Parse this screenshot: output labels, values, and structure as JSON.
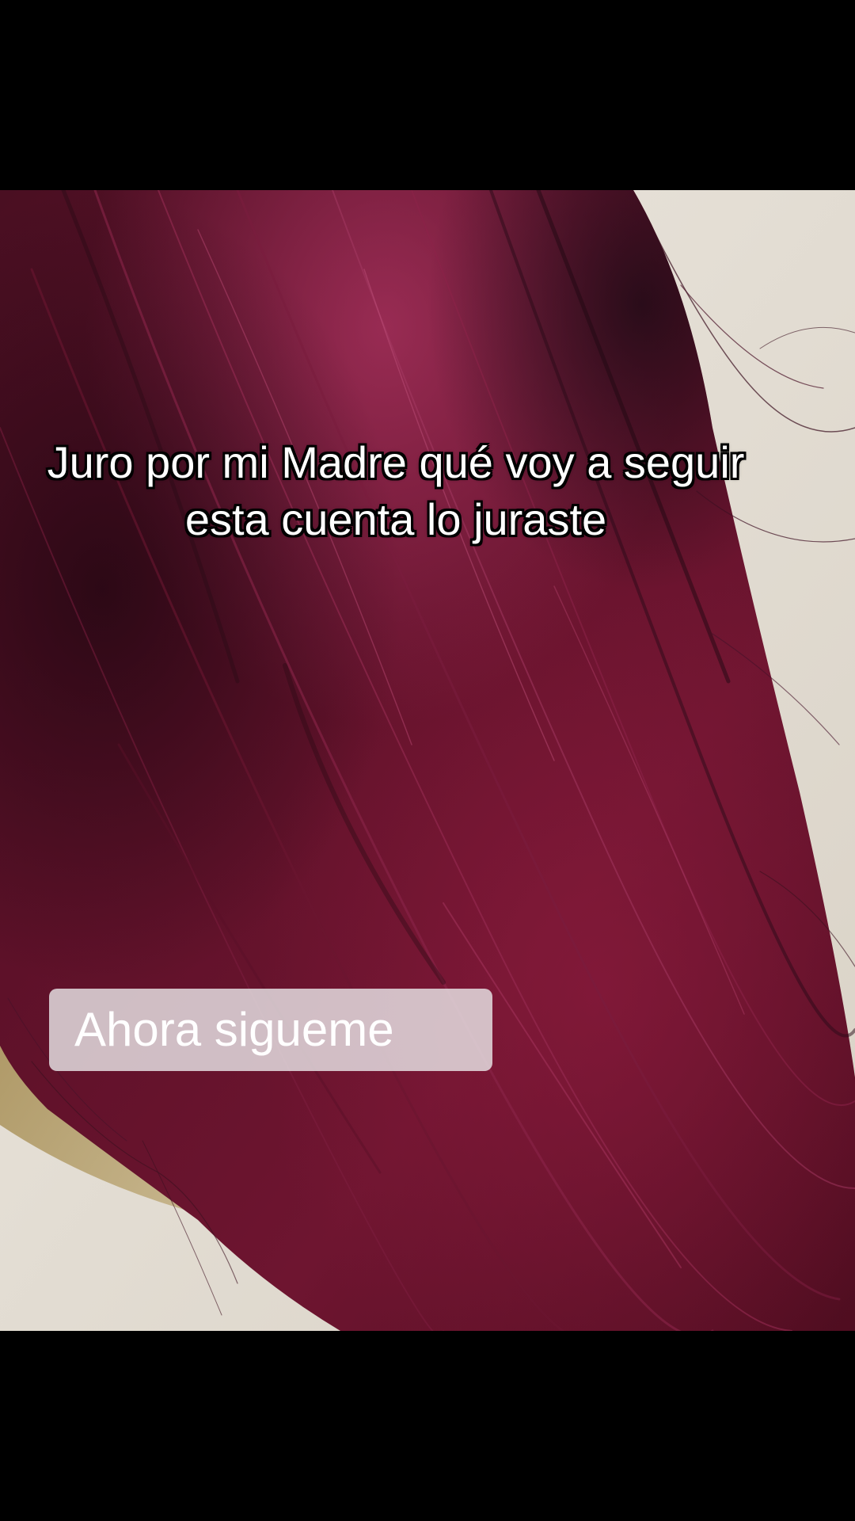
{
  "overlay_text": {
    "main_caption": "Juro por mi Madre qué voy a seguir esta cuenta lo juraste",
    "sticker_label": "Ahora sigueme"
  },
  "colors": {
    "hair_dark": "#3a0d1c",
    "hair_mid": "#6e1430",
    "hair_highlight": "#9a2a55",
    "background_wall": "#e7e1d8",
    "background_shadow": "#b8a67a",
    "letterbox": "#000000"
  }
}
